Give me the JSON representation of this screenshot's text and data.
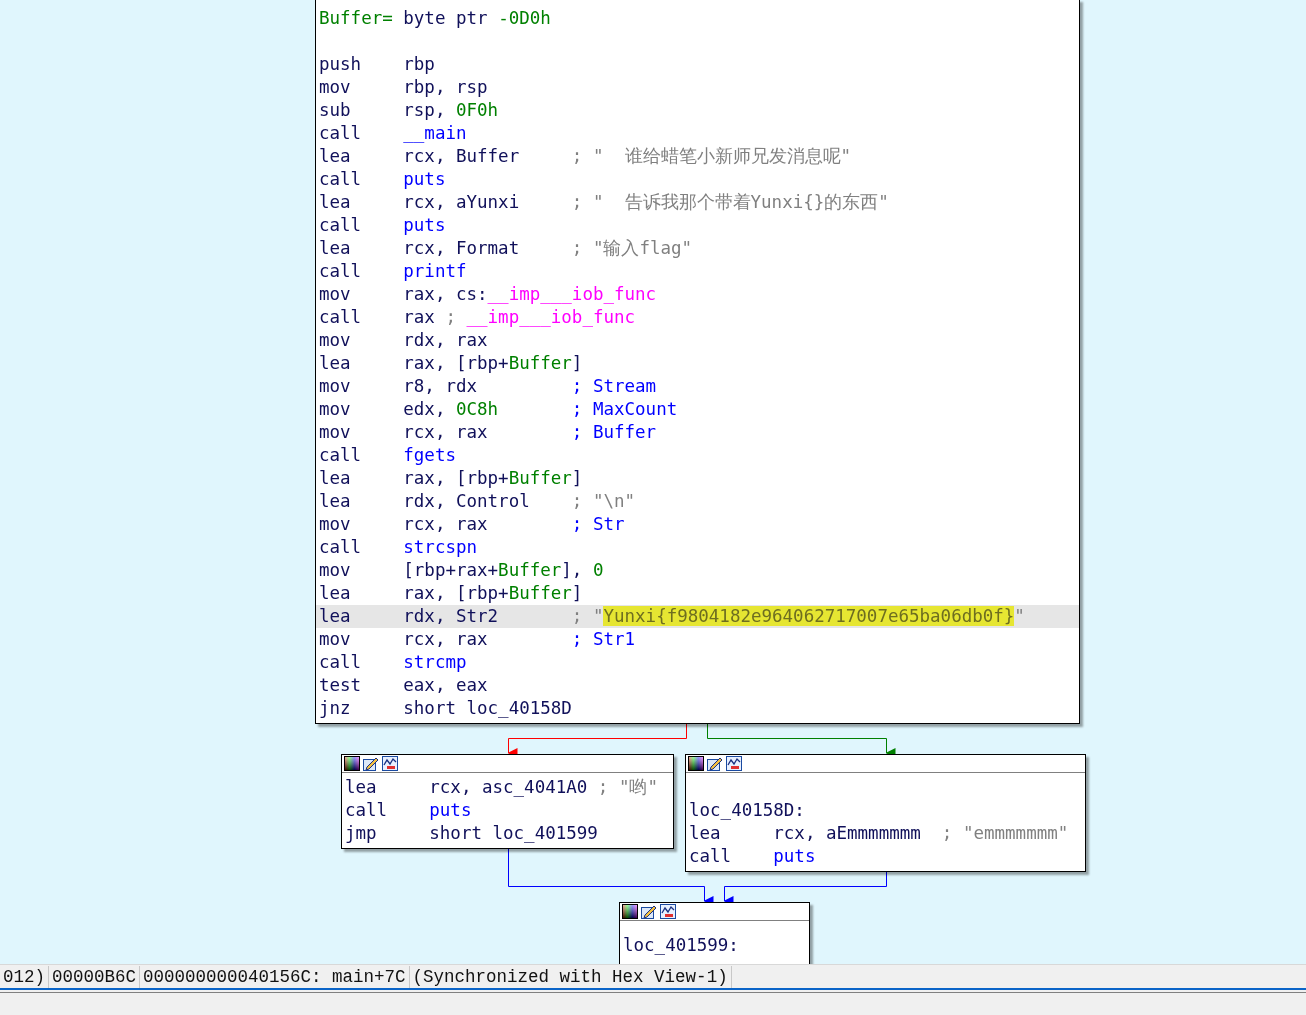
{
  "graph": {
    "blocks": [
      {
        "kind": "main",
        "lines": [
          {
            "kind": "decl",
            "selected": false,
            "parts": [
              {
                "text": "Buffer=",
                "kind": "var"
              },
              {
                "text": " byte ptr ",
                "kind": "plain"
              },
              {
                "text": "-0D0h",
                "kind": "num"
              }
            ]
          },
          {
            "kind": "blank",
            "selected": false
          },
          {
            "kind": "instr",
            "selected": false,
            "mnemonic": "push",
            "operands": [
              {
                "text": "rbp",
                "kind": "plain"
              }
            ]
          },
          {
            "kind": "instr",
            "selected": false,
            "mnemonic": "mov",
            "operands": [
              {
                "text": "rbp, rsp",
                "kind": "plain"
              }
            ]
          },
          {
            "kind": "instr",
            "selected": false,
            "mnemonic": "sub",
            "operands": [
              {
                "text": "rsp, ",
                "kind": "plain"
              },
              {
                "text": "0F0h",
                "kind": "num"
              }
            ]
          },
          {
            "kind": "instr",
            "selected": false,
            "mnemonic": "call",
            "operands": [
              {
                "text": "__main",
                "kind": "func"
              }
            ]
          },
          {
            "kind": "instr",
            "selected": false,
            "mnemonic": "lea",
            "operands": [
              {
                "text": "rcx, Buffer",
                "kind": "plain"
              }
            ],
            "comment": [
              {
                "text": "; \"  谁给蜡笔小新师兄发消息呢\"",
                "kind": "comment"
              }
            ]
          },
          {
            "kind": "instr",
            "selected": false,
            "mnemonic": "call",
            "operands": [
              {
                "text": "puts",
                "kind": "func"
              }
            ]
          },
          {
            "kind": "instr",
            "selected": false,
            "mnemonic": "lea",
            "operands": [
              {
                "text": "rcx, aYunxi",
                "kind": "plain"
              }
            ],
            "comment": [
              {
                "text": "; \"  告诉我那个带着Yunxi{}的东西\"",
                "kind": "comment"
              }
            ]
          },
          {
            "kind": "instr",
            "selected": false,
            "mnemonic": "call",
            "operands": [
              {
                "text": "puts",
                "kind": "func"
              }
            ]
          },
          {
            "kind": "instr",
            "selected": false,
            "mnemonic": "lea",
            "operands": [
              {
                "text": "rcx, Format",
                "kind": "plain"
              }
            ],
            "comment": [
              {
                "text": "; \"输入flag\"",
                "kind": "comment"
              }
            ]
          },
          {
            "kind": "instr",
            "selected": false,
            "mnemonic": "call",
            "operands": [
              {
                "text": "printf",
                "kind": "func"
              }
            ]
          },
          {
            "kind": "instr",
            "selected": false,
            "mnemonic": "mov",
            "operands": [
              {
                "text": "rax, cs:",
                "kind": "plain"
              },
              {
                "text": "__imp___iob_func",
                "kind": "import"
              }
            ]
          },
          {
            "kind": "instr",
            "selected": false,
            "mnemonic": "call",
            "operands": [
              {
                "text": "rax",
                "kind": "plain"
              },
              {
                "text": " ; ",
                "kind": "comment"
              },
              {
                "text": "__imp___iob_func",
                "kind": "import"
              }
            ]
          },
          {
            "kind": "instr",
            "selected": false,
            "mnemonic": "mov",
            "operands": [
              {
                "text": "rdx, rax",
                "kind": "plain"
              }
            ]
          },
          {
            "kind": "instr",
            "selected": false,
            "mnemonic": "lea",
            "operands": [
              {
                "text": "rax, [rbp+",
                "kind": "plain"
              },
              {
                "text": "Buffer",
                "kind": "var"
              },
              {
                "text": "]",
                "kind": "plain"
              }
            ]
          },
          {
            "kind": "instr",
            "selected": false,
            "mnemonic": "mov",
            "operands": [
              {
                "text": "r8, rdx",
                "kind": "plain"
              }
            ],
            "comment": [
              {
                "text": "; Stream",
                "kind": "ref"
              }
            ]
          },
          {
            "kind": "instr",
            "selected": false,
            "mnemonic": "mov",
            "operands": [
              {
                "text": "edx, ",
                "kind": "plain"
              },
              {
                "text": "0C8h",
                "kind": "num"
              }
            ],
            "comment": [
              {
                "text": "; MaxCount",
                "kind": "ref"
              }
            ]
          },
          {
            "kind": "instr",
            "selected": false,
            "mnemonic": "mov",
            "operands": [
              {
                "text": "rcx, rax",
                "kind": "plain"
              }
            ],
            "comment": [
              {
                "text": "; Buffer",
                "kind": "ref"
              }
            ]
          },
          {
            "kind": "instr",
            "selected": false,
            "mnemonic": "call",
            "operands": [
              {
                "text": "fgets",
                "kind": "func"
              }
            ]
          },
          {
            "kind": "instr",
            "selected": false,
            "mnemonic": "lea",
            "operands": [
              {
                "text": "rax, [rbp+",
                "kind": "plain"
              },
              {
                "text": "Buffer",
                "kind": "var"
              },
              {
                "text": "]",
                "kind": "plain"
              }
            ]
          },
          {
            "kind": "instr",
            "selected": false,
            "mnemonic": "lea",
            "operands": [
              {
                "text": "rdx, Control",
                "kind": "plain"
              }
            ],
            "comment": [
              {
                "text": "; \"\\n\"",
                "kind": "comment"
              }
            ]
          },
          {
            "kind": "instr",
            "selected": false,
            "mnemonic": "mov",
            "operands": [
              {
                "text": "rcx, rax",
                "kind": "plain"
              }
            ],
            "comment": [
              {
                "text": "; Str",
                "kind": "ref"
              }
            ]
          },
          {
            "kind": "instr",
            "selected": false,
            "mnemonic": "call",
            "operands": [
              {
                "text": "strcspn",
                "kind": "func"
              }
            ]
          },
          {
            "kind": "instr",
            "selected": false,
            "mnemonic": "mov",
            "operands": [
              {
                "text": "[rbp+rax+",
                "kind": "plain"
              },
              {
                "text": "Buffer",
                "kind": "var"
              },
              {
                "text": "], ",
                "kind": "plain"
              },
              {
                "text": "0",
                "kind": "num"
              }
            ]
          },
          {
            "kind": "instr",
            "selected": false,
            "mnemonic": "lea",
            "operands": [
              {
                "text": "rax, [rbp+",
                "kind": "plain"
              },
              {
                "text": "Buffer",
                "kind": "var"
              },
              {
                "text": "]",
                "kind": "plain"
              }
            ]
          },
          {
            "kind": "instr",
            "selected": true,
            "mnemonic": "lea",
            "operands": [
              {
                "text": "rdx, Str2",
                "kind": "plain"
              }
            ],
            "comment": [
              {
                "text": "; \"",
                "kind": "comment"
              },
              {
                "text": "Yunxi{f9804182e964062717007e65ba06db0f}",
                "kind": "highlight"
              },
              {
                "text": "\"",
                "kind": "comment"
              }
            ]
          },
          {
            "kind": "instr",
            "selected": false,
            "mnemonic": "mov",
            "operands": [
              {
                "text": "rcx, rax",
                "kind": "plain"
              }
            ],
            "comment": [
              {
                "text": "; Str1",
                "kind": "ref"
              }
            ]
          },
          {
            "kind": "instr",
            "selected": false,
            "mnemonic": "call",
            "operands": [
              {
                "text": "strcmp",
                "kind": "func"
              }
            ]
          },
          {
            "kind": "instr",
            "selected": false,
            "mnemonic": "test",
            "operands": [
              {
                "text": "eax, eax",
                "kind": "plain"
              }
            ]
          },
          {
            "kind": "instr",
            "selected": false,
            "mnemonic": "jnz",
            "operands": [
              {
                "text": "short loc_40158D",
                "kind": "plain"
              }
            ]
          }
        ]
      },
      {
        "kind": "left",
        "lines": [
          {
            "kind": "instr",
            "selected": false,
            "mnemonic": "lea",
            "operands": [
              {
                "text": "rcx, asc_4041A0",
                "kind": "plain"
              }
            ],
            "comment": [
              {
                "text": "; \"哟\"",
                "kind": "comment"
              }
            ]
          },
          {
            "kind": "instr",
            "selected": false,
            "mnemonic": "call",
            "operands": [
              {
                "text": "puts",
                "kind": "func"
              }
            ]
          },
          {
            "kind": "instr",
            "selected": false,
            "mnemonic": "jmp",
            "operands": [
              {
                "text": "short loc_401599",
                "kind": "plain"
              }
            ]
          }
        ]
      },
      {
        "kind": "right",
        "lines": [
          {
            "kind": "blank",
            "selected": false
          },
          {
            "kind": "label",
            "selected": false,
            "parts": [
              {
                "text": "loc_40158D:",
                "kind": "plain"
              }
            ]
          },
          {
            "kind": "instr",
            "selected": false,
            "mnemonic": "lea",
            "operands": [
              {
                "text": "rcx, aEmmmmmmm",
                "kind": "plain"
              }
            ],
            "comment": [
              {
                "text": "; \"emmmmmmm\"",
                "kind": "comment"
              }
            ]
          },
          {
            "kind": "instr",
            "selected": false,
            "mnemonic": "call",
            "operands": [
              {
                "text": "puts",
                "kind": "func"
              }
            ]
          }
        ]
      },
      {
        "kind": "bottom",
        "lines": [
          {
            "kind": "blank",
            "selected": false
          },
          {
            "kind": "label",
            "selected": false,
            "parts": [
              {
                "text": "loc_401599:",
                "kind": "plain"
              }
            ]
          }
        ]
      }
    ]
  },
  "status_bar": {
    "cells": [
      "012)",
      "00000B6C",
      "000000000040156C: main+7C",
      "(Synchronized with Hex View-1)"
    ]
  }
}
